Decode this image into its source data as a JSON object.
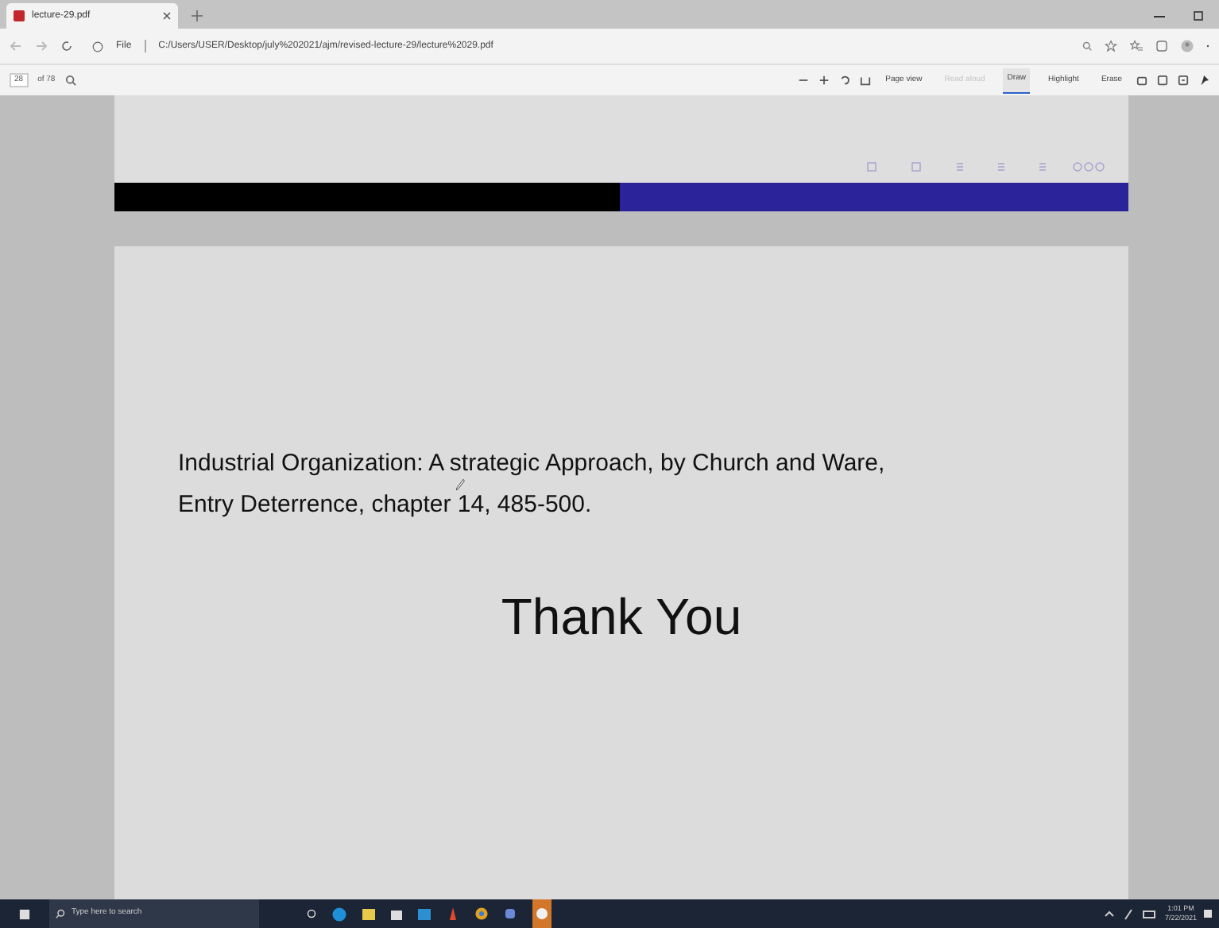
{
  "browser": {
    "tab": {
      "title": "lecture-29.pdf",
      "selected": true
    },
    "address": {
      "scheme": "File",
      "url": "C:/Users/USER/Desktop/july%202021/ajm/revised-lecture-29/lecture%2029.pdf"
    }
  },
  "pdf_toolbar": {
    "page_number": "28",
    "page_count": "of 78",
    "items": [
      {
        "kind": "tool",
        "label": "Page view",
        "disabled": false,
        "selected": false
      },
      {
        "kind": "tool",
        "label": "Read aloud",
        "disabled": true,
        "selected": false
      },
      {
        "kind": "tool",
        "label": "Draw",
        "disabled": false,
        "selected": true
      },
      {
        "kind": "tool",
        "label": "Highlight",
        "disabled": false,
        "selected": false
      },
      {
        "kind": "tool",
        "label": "Erase",
        "disabled": false,
        "selected": false
      }
    ]
  },
  "document": {
    "reference_lines": [
      "Industrial Organization: A strategic Approach, by Church and Ware,",
      "Entry Deterrence, chapter 14, 485-500."
    ],
    "closing": "Thank You"
  },
  "taskbar": {
    "search_placeholder": "Type here to search",
    "time": "1:01 PM",
    "date": "7/22/2021"
  }
}
